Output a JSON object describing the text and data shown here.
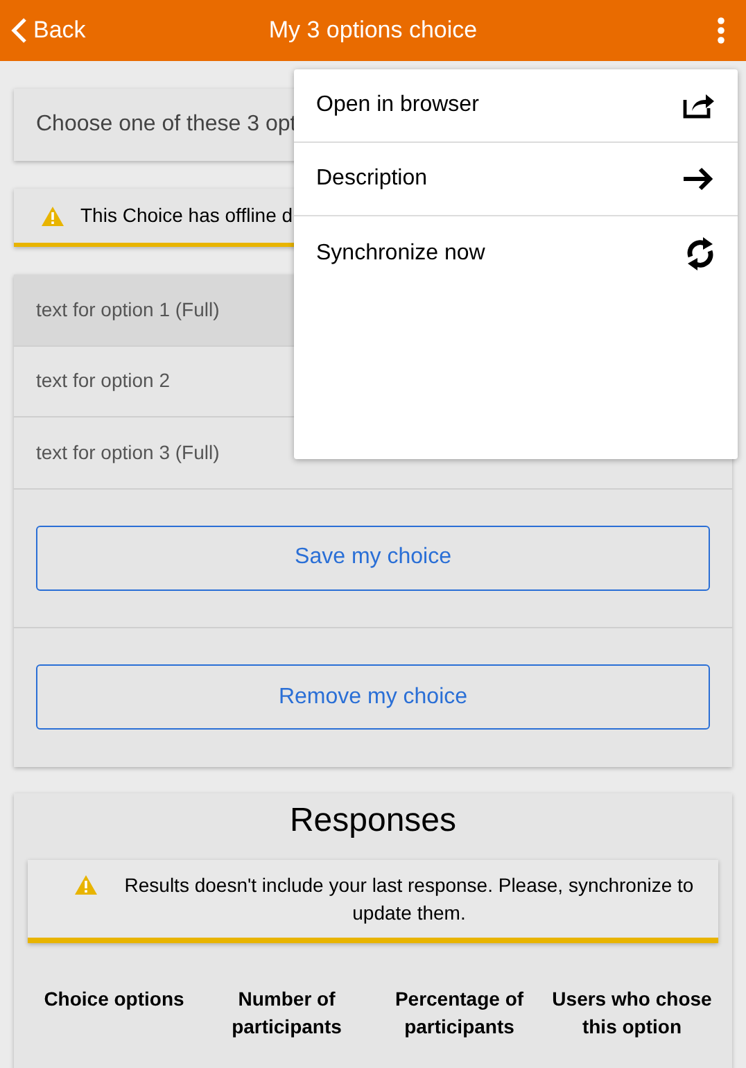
{
  "header": {
    "back_label": "Back",
    "title": "My 3 options choice"
  },
  "intro": {
    "text": "Choose one of these 3 opt"
  },
  "offline_notice": {
    "text": "This Choice has offline d"
  },
  "options": [
    {
      "label": "text for option 1 (Full)",
      "selected": true
    },
    {
      "label": "text for option 2",
      "selected": false
    },
    {
      "label": "text for option 3 (Full)",
      "selected": false
    }
  ],
  "buttons": [
    {
      "label": "Save my choice"
    },
    {
      "label": "Remove my choice"
    }
  ],
  "responses": {
    "title": "Responses",
    "notice": "Results doesn't include your last response. Please, synchronize to update them.",
    "columns": [
      "Choice options",
      "Number of participants",
      "Percentage of participants",
      "Users who chose this option"
    ]
  },
  "menu": [
    {
      "label": "Open in browser",
      "kind": "share"
    },
    {
      "label": "Description",
      "kind": "arrow"
    },
    {
      "label": "Synchronize now",
      "kind": "sync"
    }
  ]
}
